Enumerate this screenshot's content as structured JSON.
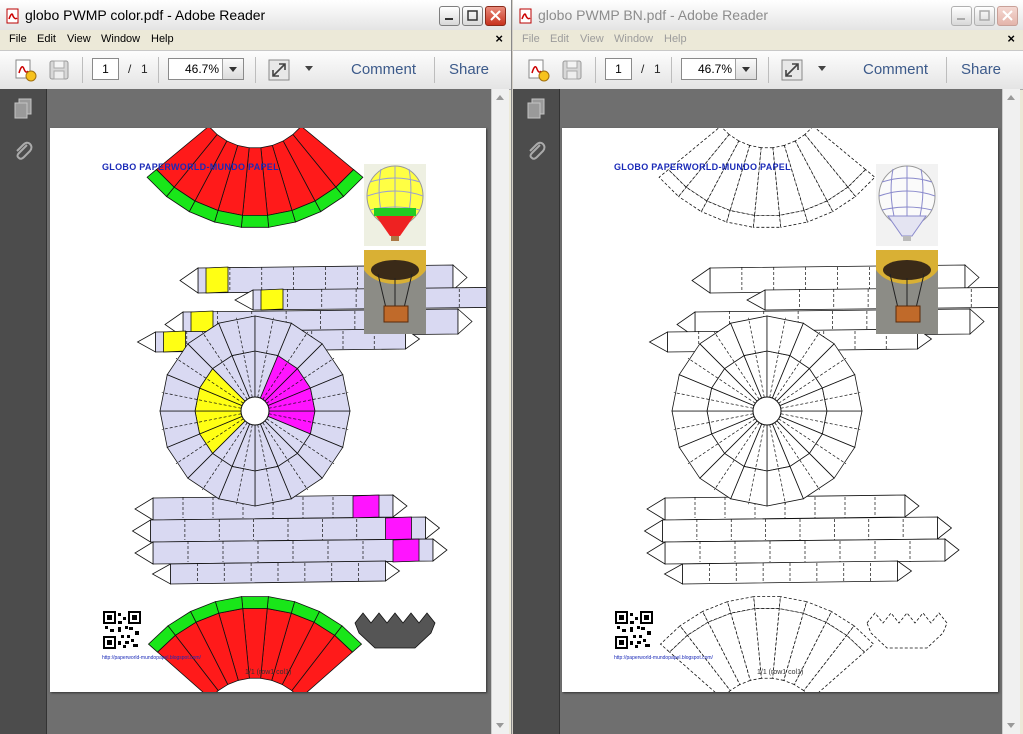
{
  "windows": [
    {
      "id": "left",
      "title": "globo PWMP color.pdf - Adobe Reader",
      "active": true,
      "menu": [
        "File",
        "Edit",
        "View",
        "Window",
        "Help"
      ],
      "toolbar": {
        "page_current": "1",
        "page_sep": "/",
        "page_total": "1",
        "zoom": "46.7%",
        "comment_label": "Comment",
        "share_label": "Share"
      },
      "page": {
        "title": "GLOBO PAPERWORLD-MUNDO PAPEL",
        "url": "http://paperworld-mundopapel.blogspot.com/",
        "page_number": "1/1 (row1 col1)",
        "color_mode": "color"
      }
    },
    {
      "id": "right",
      "title": "globo PWMP BN.pdf - Adobe Reader",
      "active": false,
      "menu": [
        "File",
        "Edit",
        "View",
        "Window",
        "Help"
      ],
      "toolbar": {
        "page_current": "1",
        "page_sep": "/",
        "page_total": "1",
        "zoom": "46.7%",
        "comment_label": "Comment",
        "share_label": "Share"
      },
      "page": {
        "title": "GLOBO PAPERWORLD-MUNDO PAPEL",
        "url": "http://paperworld-mundopapel.blogspot.com/",
        "page_number": "1/1 (row1 col1)",
        "color_mode": "bw"
      }
    }
  ],
  "colors": {
    "red": "#ff1a1a",
    "green": "#19e619",
    "lavender": "#d9d9f2",
    "yellow": "#ffff14",
    "magenta": "#ff14ff",
    "title_blue": "#1a2ab8",
    "reader_link": "#3c5a8a"
  },
  "icons": [
    "pdf-file-icon",
    "create-pdf-icon",
    "save-icon",
    "fit-page-icon",
    "pages-panel-icon",
    "attachments-icon",
    "minimize-icon",
    "maximize-icon",
    "close-icon"
  ]
}
